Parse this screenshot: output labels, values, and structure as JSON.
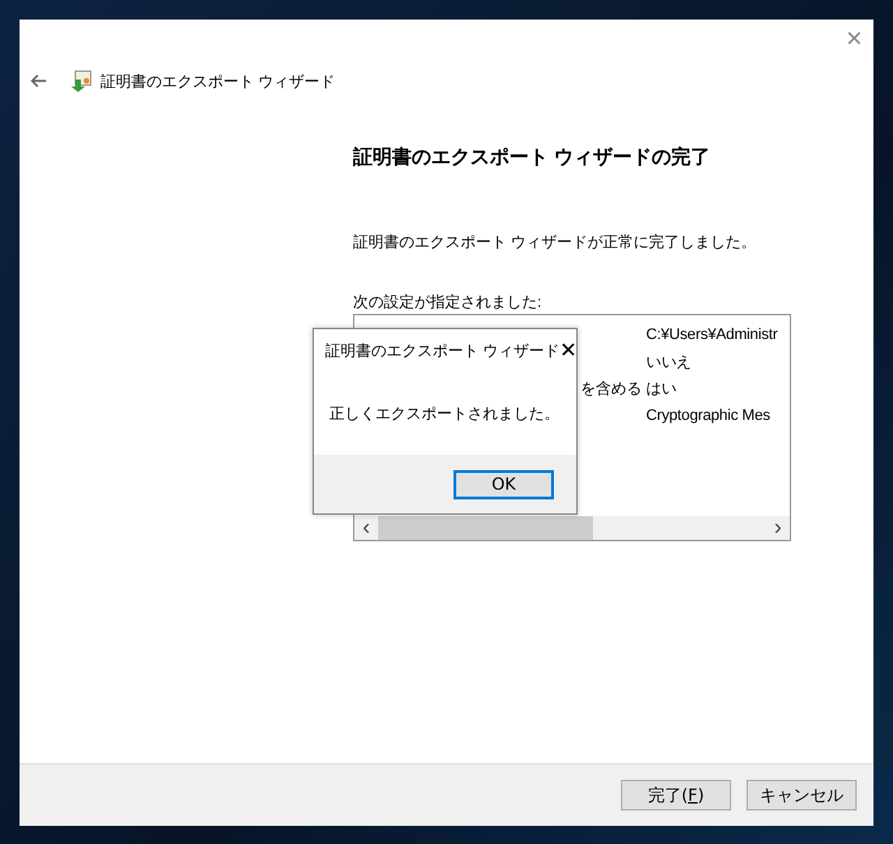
{
  "window": {
    "title": "証明書のエクスポート ウィザード",
    "close": "×"
  },
  "heading": "証明書のエクスポート ウィザードの完了",
  "message": "証明書のエクスポート ウィザードが正常に完了しました。",
  "settings_label": "次の設定が指定されました:",
  "settings": [
    {
      "value": "C:¥Users¥Administr"
    },
    {
      "value": "いいえ"
    },
    {
      "label": "を含める",
      "value": "はい"
    },
    {
      "value": "Cryptographic Mes"
    }
  ],
  "scrollbar": {
    "left": "‹",
    "right": "›"
  },
  "buttons": [
    {
      "label": "完了(",
      "key": "F",
      "tail": ")"
    },
    {
      "label": "キャンセル"
    }
  ],
  "dialog": {
    "title": "証明書のエクスポート ウィザード",
    "close": "✕",
    "message": "正しくエクスポートされました。",
    "button": "OK"
  }
}
